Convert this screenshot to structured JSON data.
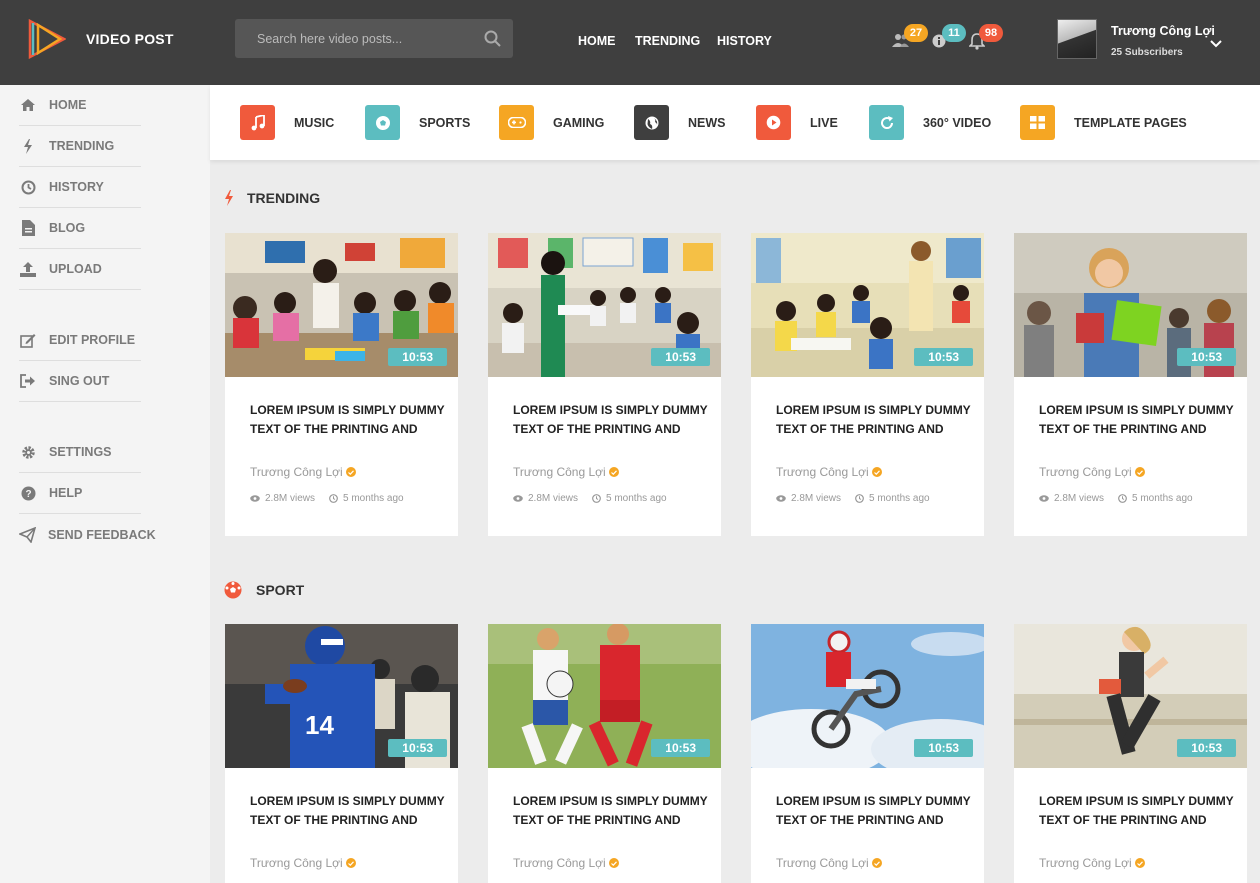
{
  "brand": "VIDEO POST",
  "search": {
    "placeholder": "Search here video posts..."
  },
  "topnav": [
    "HOME",
    "TRENDING",
    "HISTORY"
  ],
  "notifications": [
    {
      "icon": "users-icon",
      "count": "27",
      "color": "#f5a623"
    },
    {
      "icon": "info-icon",
      "count": "11",
      "color": "#5cbdc0"
    },
    {
      "icon": "bell-icon",
      "count": "98",
      "color": "#f05a3c"
    }
  ],
  "user": {
    "name": "Trương Công Lợi",
    "subscribers": "25 Subscribers"
  },
  "sidebar": {
    "group1": [
      {
        "label": "HOME",
        "icon": "home-icon"
      },
      {
        "label": "TRENDING",
        "icon": "bolt-icon"
      },
      {
        "label": "HISTORY",
        "icon": "clock-icon"
      },
      {
        "label": "BLOG",
        "icon": "file-icon"
      },
      {
        "label": "UPLOAD",
        "icon": "upload-icon"
      }
    ],
    "group2": [
      {
        "label": "EDIT PROFILE",
        "icon": "edit-icon"
      },
      {
        "label": "SING OUT",
        "icon": "signout-icon"
      }
    ],
    "group3": [
      {
        "label": "SETTINGS",
        "icon": "gear-icon"
      },
      {
        "label": "HELP",
        "icon": "help-icon"
      },
      {
        "label": "SEND FEEDBACK",
        "icon": "send-icon"
      }
    ]
  },
  "categories": [
    {
      "label": "MUSIC",
      "color": "#f05a3c",
      "icon": "music-icon"
    },
    {
      "label": "SPORTS",
      "color": "#5cbdc0",
      "icon": "ball-icon"
    },
    {
      "label": "GAMING",
      "color": "#f5a623",
      "icon": "gamepad-icon"
    },
    {
      "label": "NEWS",
      "color": "#3f3f3f",
      "icon": "globe-icon"
    },
    {
      "label": "LIVE",
      "color": "#f05a3c",
      "icon": "play-icon"
    },
    {
      "label": "360° VIDEO",
      "color": "#5cbdc0",
      "icon": "refresh-icon"
    },
    {
      "label": "TEMPLATE PAGES",
      "color": "#f5a623",
      "icon": "grid-icon"
    }
  ],
  "sections": {
    "trending": {
      "title": "TRENDING",
      "cards": [
        {
          "duration": "10:53",
          "title": "LOREM IPSUM IS SIMPLY DUMMY TEXT OF THE PRINTING AND",
          "author": "Trương Công Lợi",
          "views": "2.8M views",
          "time": "5 months ago"
        },
        {
          "duration": "10:53",
          "title": "LOREM IPSUM IS SIMPLY DUMMY TEXT OF THE PRINTING AND",
          "author": "Trương Công Lợi",
          "views": "2.8M views",
          "time": "5 months ago"
        },
        {
          "duration": "10:53",
          "title": "LOREM IPSUM IS SIMPLY DUMMY TEXT OF THE PRINTING AND",
          "author": "Trương Công Lợi",
          "views": "2.8M views",
          "time": "5 months ago"
        },
        {
          "duration": "10:53",
          "title": "LOREM IPSUM IS SIMPLY DUMMY TEXT OF THE PRINTING AND",
          "author": "Trương Công Lợi",
          "views": "2.8M views",
          "time": "5 months ago"
        }
      ]
    },
    "sport": {
      "title": "SPORT",
      "cards": [
        {
          "duration": "10:53",
          "title": "LOREM IPSUM IS SIMPLY DUMMY TEXT OF THE PRINTING AND",
          "author": "Trương Công Lợi"
        },
        {
          "duration": "10:53",
          "title": "LOREM IPSUM IS SIMPLY DUMMY TEXT OF THE PRINTING AND",
          "author": "Trương Công Lợi"
        },
        {
          "duration": "10:53",
          "title": "LOREM IPSUM IS SIMPLY DUMMY TEXT OF THE PRINTING AND",
          "author": "Trương Công Lợi"
        },
        {
          "duration": "10:53",
          "title": "LOREM IPSUM IS SIMPLY DUMMY TEXT OF THE PRINTING AND",
          "author": "Trương Công Lợi"
        }
      ]
    }
  }
}
